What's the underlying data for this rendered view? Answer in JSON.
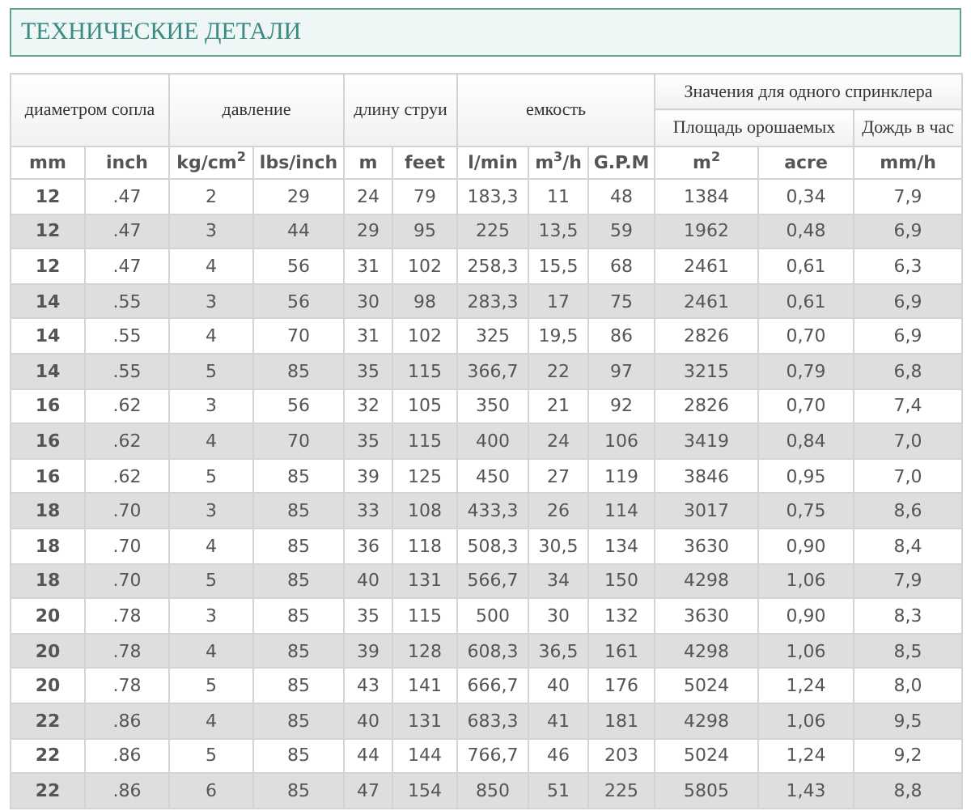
{
  "title": "ТЕХНИЧЕСКИЕ ДЕТАЛИ",
  "table": {
    "groups": [
      "диаметром сопла",
      "давление",
      "длину струи",
      "емкость"
    ],
    "group_right": {
      "label": "Значения для одного спринклера",
      "subgroups": [
        "Площадь орошаемых",
        "Дождь в час"
      ]
    },
    "units": [
      "mm",
      "inch",
      "kg/cm$^{2}$",
      "lbs/inch",
      "m",
      "feet",
      "l/min",
      "m$^{3}$/h",
      "G.P.M",
      "m$^{2}$",
      "acre",
      "mm/h"
    ],
    "rows": [
      [
        "12",
        ".47",
        "2",
        "29",
        "24",
        "79",
        "183,3",
        "11",
        "48",
        "1384",
        "0,34",
        "7,9"
      ],
      [
        "12",
        ".47",
        "3",
        "44",
        "29",
        "95",
        "225",
        "13,5",
        "59",
        "1962",
        "0,48",
        "6,9"
      ],
      [
        "12",
        ".47",
        "4",
        "56",
        "31",
        "102",
        "258,3",
        "15,5",
        "68",
        "2461",
        "0,61",
        "6,3"
      ],
      [
        "14",
        ".55",
        "3",
        "56",
        "30",
        "98",
        "283,3",
        "17",
        "75",
        "2461",
        "0,61",
        "6,9"
      ],
      [
        "14",
        ".55",
        "4",
        "70",
        "31",
        "102",
        "325",
        "19,5",
        "86",
        "2826",
        "0,70",
        "6,9"
      ],
      [
        "14",
        ".55",
        "5",
        "85",
        "35",
        "115",
        "366,7",
        "22",
        "97",
        "3215",
        "0,79",
        "6,8"
      ],
      [
        "16",
        ".62",
        "3",
        "56",
        "32",
        "105",
        "350",
        "21",
        "92",
        "2826",
        "0,70",
        "7,4"
      ],
      [
        "16",
        ".62",
        "4",
        "70",
        "35",
        "115",
        "400",
        "24",
        "106",
        "3419",
        "0,84",
        "7,0"
      ],
      [
        "16",
        ".62",
        "5",
        "85",
        "39",
        "125",
        "450",
        "27",
        "119",
        "3846",
        "0,95",
        "7,0"
      ],
      [
        "18",
        ".70",
        "3",
        "85",
        "33",
        "108",
        "433,3",
        "26",
        "114",
        "3017",
        "0,75",
        "8,6"
      ],
      [
        "18",
        ".70",
        "4",
        "85",
        "36",
        "118",
        "508,3",
        "30,5",
        "134",
        "3630",
        "0,90",
        "8,4"
      ],
      [
        "18",
        ".70",
        "5",
        "85",
        "40",
        "131",
        "566,7",
        "34",
        "150",
        "4298",
        "1,06",
        "7,9"
      ],
      [
        "20",
        ".78",
        "3",
        "85",
        "35",
        "115",
        "500",
        "30",
        "132",
        "3630",
        "0,90",
        "8,3"
      ],
      [
        "20",
        ".78",
        "4",
        "85",
        "39",
        "128",
        "608,3",
        "36,5",
        "161",
        "4298",
        "1,06",
        "8,5"
      ],
      [
        "20",
        ".78",
        "5",
        "85",
        "43",
        "141",
        "666,7",
        "40",
        "176",
        "5024",
        "1,24",
        "8,0"
      ],
      [
        "22",
        ".86",
        "4",
        "85",
        "40",
        "131",
        "683,3",
        "41",
        "181",
        "4298",
        "1,06",
        "9,5"
      ],
      [
        "22",
        ".86",
        "5",
        "85",
        "44",
        "144",
        "766,7",
        "46",
        "203",
        "5024",
        "1,24",
        "9,2"
      ],
      [
        "22",
        ".86",
        "6",
        "85",
        "47",
        "154",
        "850",
        "51",
        "225",
        "5805",
        "1,43",
        "8,8"
      ]
    ]
  }
}
